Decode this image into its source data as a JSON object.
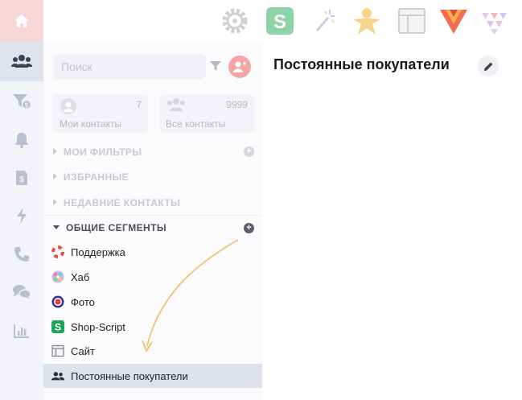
{
  "topbar": {
    "apps": [
      {
        "name": "settings-app-icon",
        "glyph": "gear"
      },
      {
        "name": "shop-script-app-icon",
        "glyph": "S"
      },
      {
        "name": "magic-app-icon",
        "glyph": "sparkle"
      },
      {
        "name": "person-app-icon",
        "glyph": "person"
      },
      {
        "name": "site-app-icon",
        "glyph": "window"
      },
      {
        "name": "vendor-app-icon",
        "glyph": "V"
      },
      {
        "name": "triangles-app-icon",
        "glyph": "triangles"
      }
    ]
  },
  "sidebar": {
    "search_placeholder": "Поиск",
    "cards": [
      {
        "label": "Мои контакты",
        "count": "7"
      },
      {
        "label": "Все контакты",
        "count": "9999"
      }
    ],
    "sections": [
      {
        "label": "МОИ ФИЛЬТРЫ"
      },
      {
        "label": "ИЗБРАННЫЕ"
      },
      {
        "label": "НЕДАВНИЕ КОНТАКТЫ"
      },
      {
        "label": "ОБЩИЕ СЕГМЕНТЫ"
      }
    ],
    "segments": [
      {
        "label": "Поддержка",
        "icon": "lifebuoy-icon"
      },
      {
        "label": "Хаб",
        "icon": "hub-icon"
      },
      {
        "label": "Фото",
        "icon": "photo-icon"
      },
      {
        "label": "Shop-Script",
        "icon": "shop-script-icon"
      },
      {
        "label": "Сайт",
        "icon": "site-icon"
      },
      {
        "label": "Постоянные покупатели",
        "icon": "users-icon"
      }
    ]
  },
  "main": {
    "title": "Постоянные покупатели"
  },
  "colors": {
    "accent_red": "#f26d6d",
    "shop_green": "#1fa35b",
    "arrow": "#f5c16e"
  }
}
